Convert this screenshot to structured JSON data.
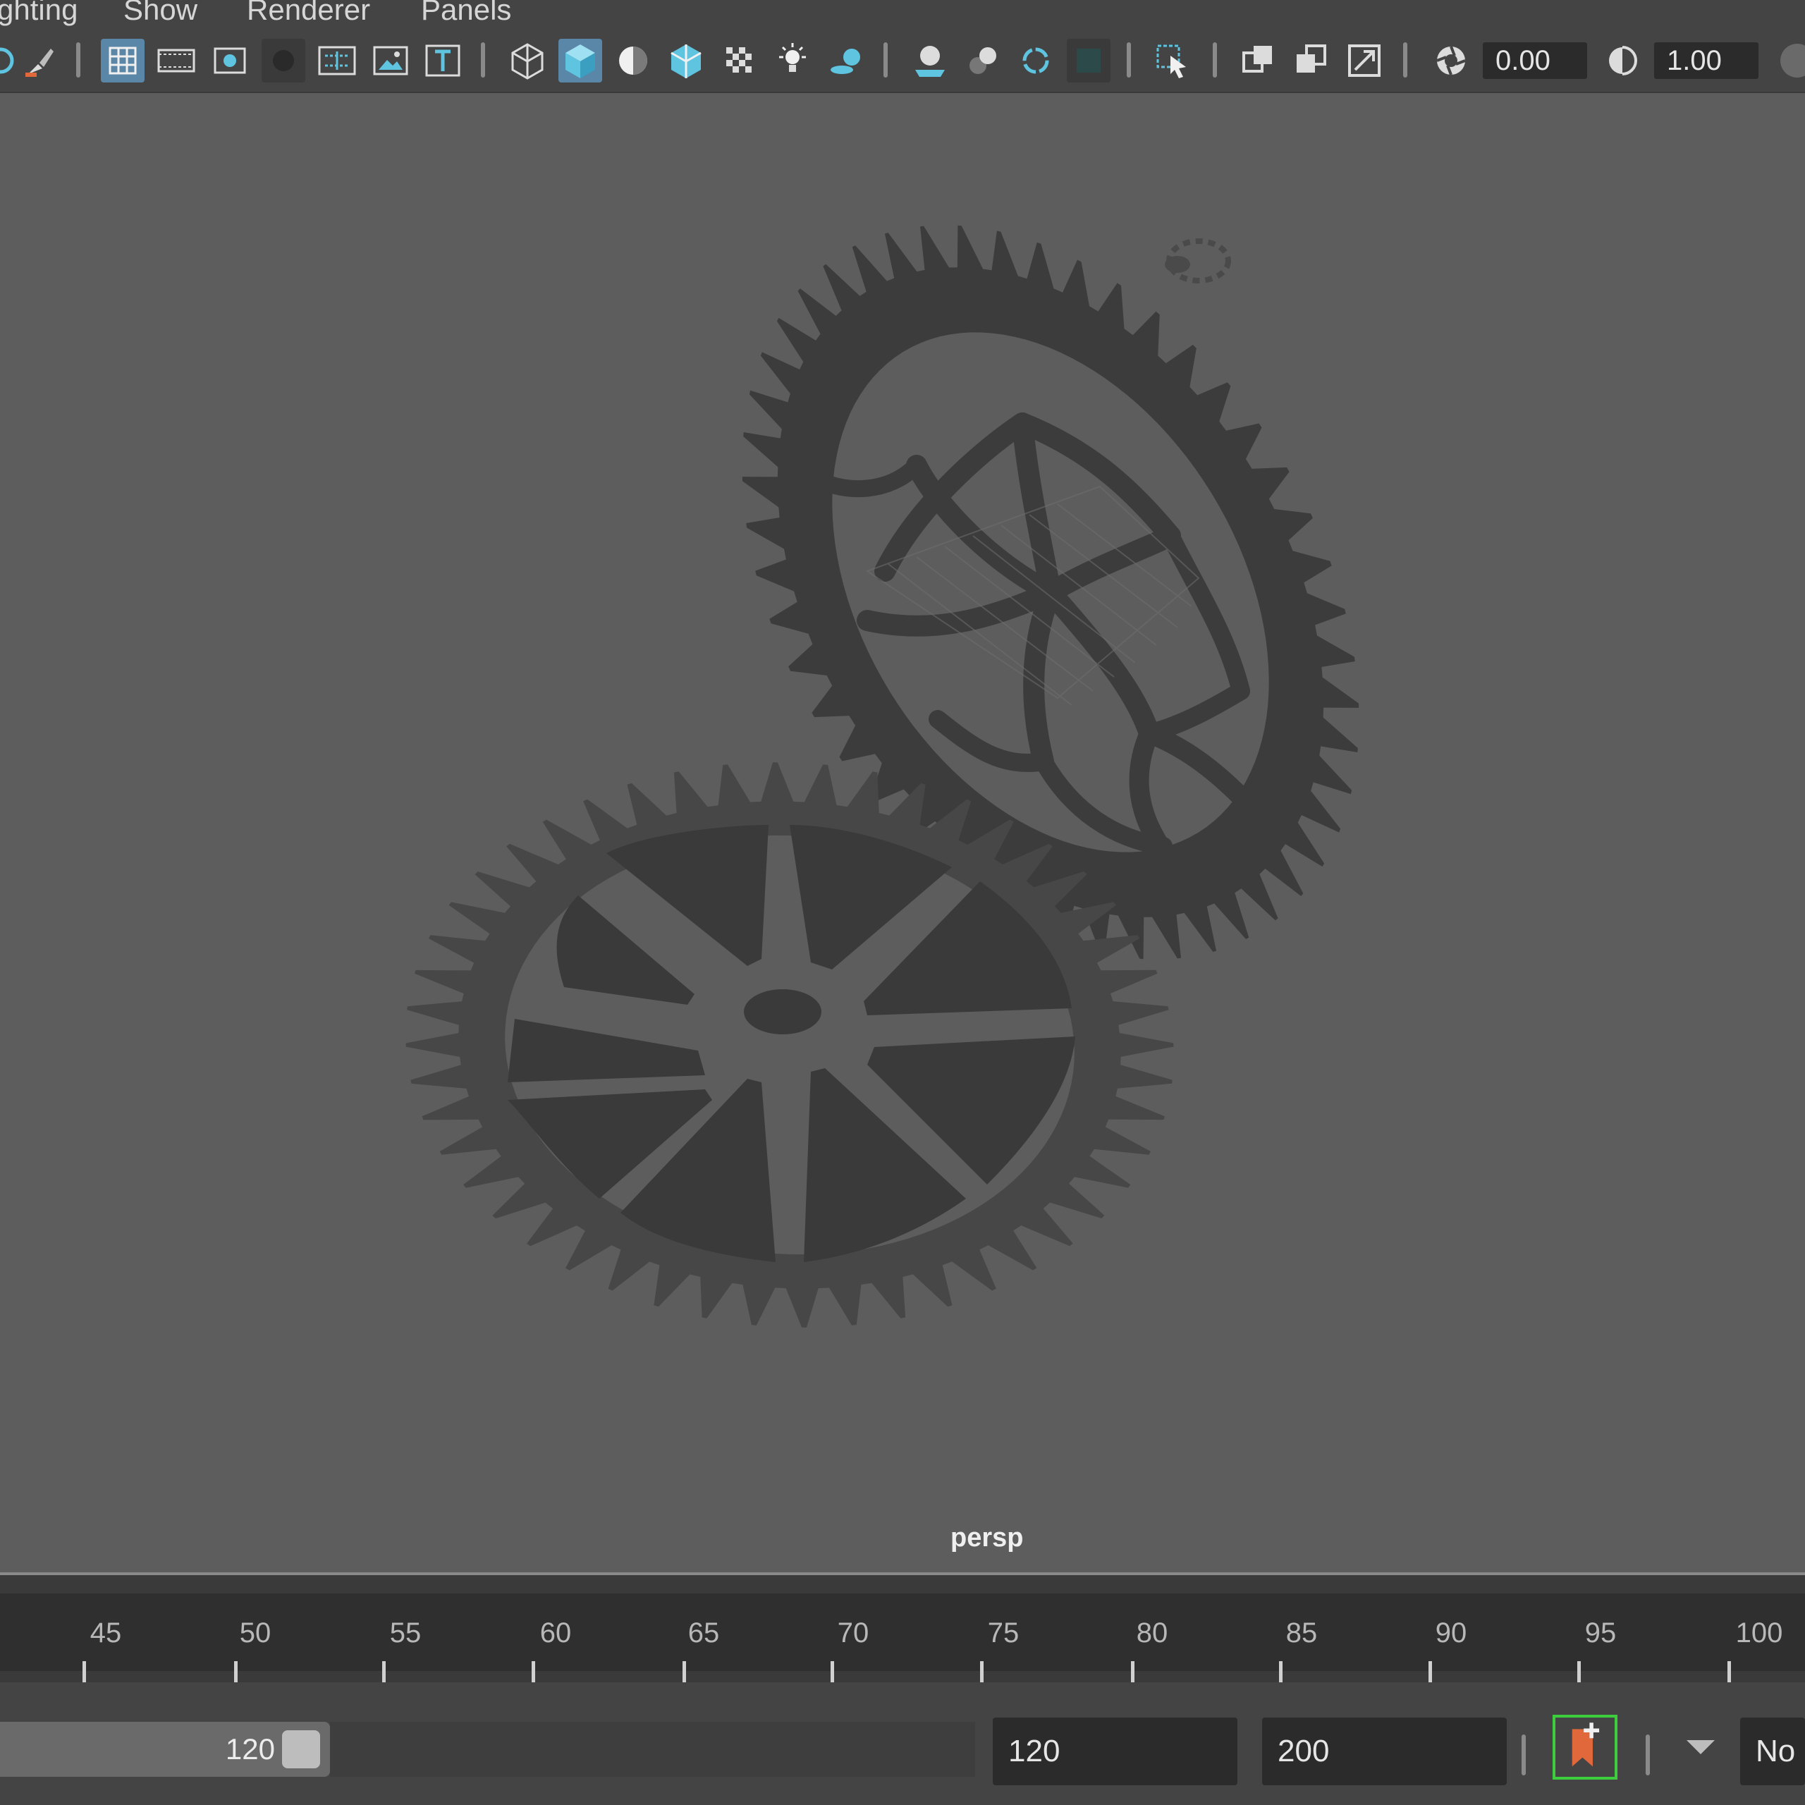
{
  "menu": {
    "items": [
      "ghting",
      "Show",
      "Renderer",
      "Panels"
    ]
  },
  "toolbar": {
    "buttons": [
      {
        "name": "camera-icon"
      },
      {
        "name": "paint-brush-icon"
      },
      {
        "name": "grid-icon",
        "active": true
      },
      {
        "name": "film-gate-icon"
      },
      {
        "name": "resolution-gate-icon"
      },
      {
        "name": "gate-mask-icon"
      },
      {
        "name": "field-chart-icon"
      },
      {
        "name": "safe-action-icon"
      },
      {
        "name": "safe-title-icon"
      },
      {
        "name": "wireframe-icon"
      },
      {
        "name": "smooth-shade-icon",
        "active": true
      },
      {
        "name": "shade-default-material-icon"
      },
      {
        "name": "wireframe-on-shaded-icon"
      },
      {
        "name": "textured-icon"
      },
      {
        "name": "use-all-lights-icon"
      },
      {
        "name": "shadows-icon"
      },
      {
        "name": "screen-space-ambient-occlusion-icon"
      },
      {
        "name": "motion-blur-icon"
      },
      {
        "name": "multisample-anti-aliasing-icon"
      },
      {
        "name": "depth-of-field-icon"
      },
      {
        "name": "isolate-select-icon"
      },
      {
        "name": "xray-icon"
      },
      {
        "name": "xray-active-components-icon"
      },
      {
        "name": "xray-joints-icon"
      },
      {
        "name": "exposure-icon"
      },
      {
        "name": "gamma-icon"
      }
    ],
    "exposure_value": "0.00",
    "gamma_value": "1.00"
  },
  "viewport": {
    "camera_label": "persp",
    "background": "#5d5d5d",
    "gear_color": "#3c3c3c",
    "gear_top_color": "#474747"
  },
  "timeline": {
    "ticks": [
      "45",
      "50",
      "55",
      "60",
      "65",
      "70",
      "75",
      "80",
      "85",
      "90",
      "95",
      "100"
    ]
  },
  "range": {
    "slider_end": "120",
    "end_time": "120",
    "anim_end": "200",
    "char_set": "No"
  },
  "colors": {
    "accent": "#5a86a8",
    "icon_cyan": "#5fc4e0",
    "key_orange": "#e0683b",
    "key_green": "#3dce3d"
  }
}
